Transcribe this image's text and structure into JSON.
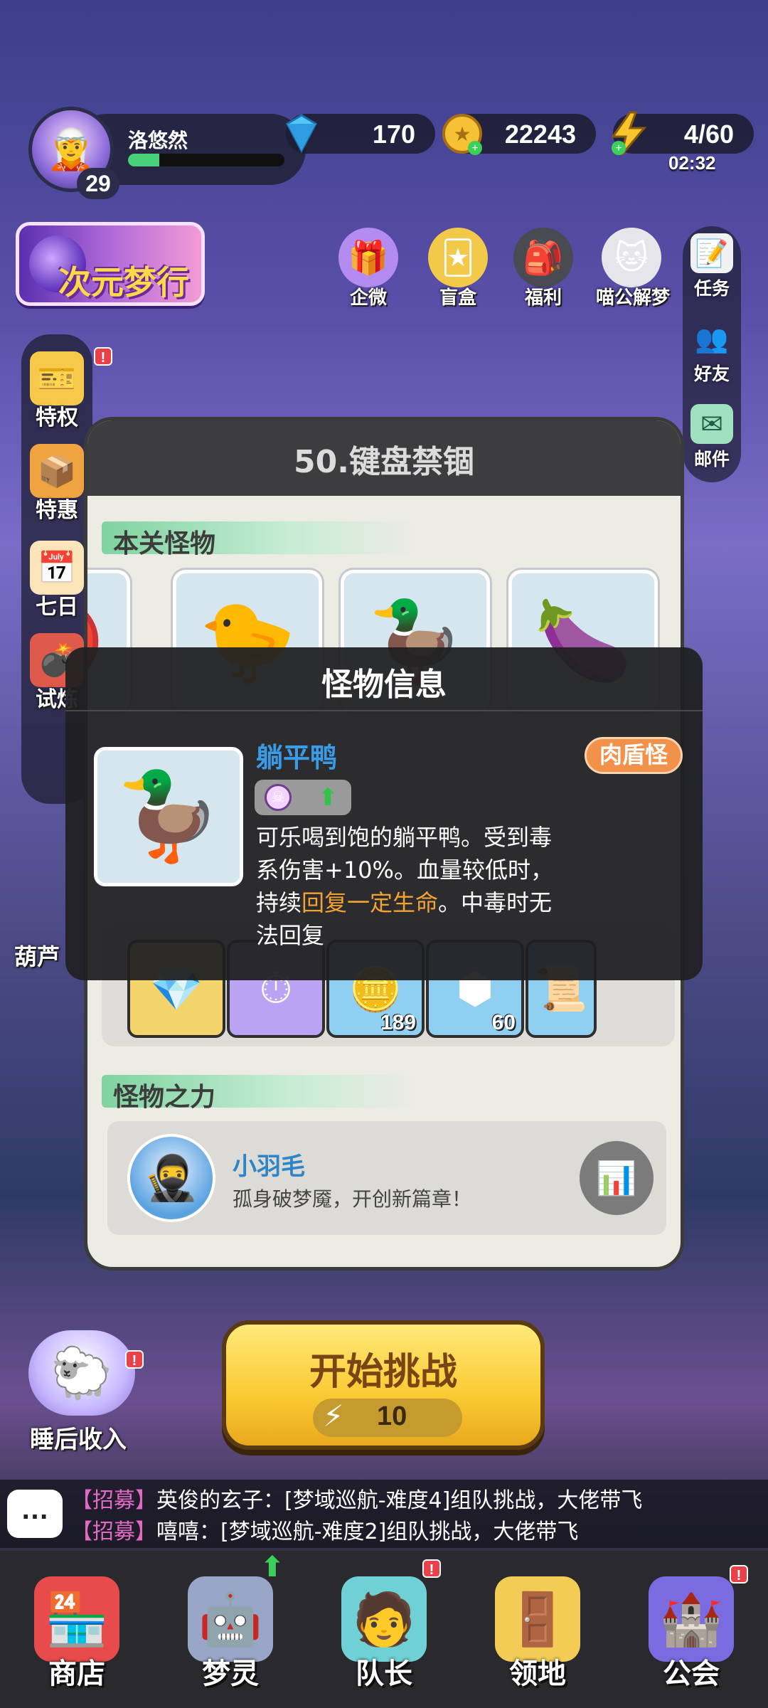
{
  "player": {
    "name": "洛悠然",
    "level": "29",
    "xp_fraction": 0.2
  },
  "resources": {
    "gems": "170",
    "coins": "22243",
    "energy": "4/60",
    "energy_timer": "02:32"
  },
  "banner": {
    "label": "次元梦行"
  },
  "top_icons": [
    {
      "label": "企微",
      "icon": "gift-icon"
    },
    {
      "label": "盲盒",
      "icon": "card-icon"
    },
    {
      "label": "福利",
      "icon": "bag-icon"
    },
    {
      "label": "喵公解梦",
      "icon": "cat-icon"
    }
  ],
  "right_menu": [
    {
      "label": "任务",
      "icon": "notebook-icon"
    },
    {
      "label": "好友",
      "icon": "friends-icon"
    },
    {
      "label": "邮件",
      "icon": "mail-icon"
    }
  ],
  "left_menu": [
    {
      "label": "特权",
      "icon": "tickets-icon"
    },
    {
      "label": "特惠",
      "icon": "box-icon"
    },
    {
      "label": "七日",
      "icon": "calendar-icon"
    },
    {
      "label": "试炼",
      "icon": "cannon-icon"
    }
  ],
  "left_extra": {
    "gourd_label": "葫芦"
  },
  "stage": {
    "title": "50.键盘禁锢",
    "monsters_header": "本关怪物",
    "power_header": "怪物之力",
    "reward_counts": [
      "189",
      "60"
    ],
    "power": {
      "name": "小羽毛",
      "desc": "孤身破梦魇，开创新篇章！"
    }
  },
  "monster_info": {
    "header": "怪物信息",
    "name": "躺平鸭",
    "type": "肉盾怪",
    "desc_part1": "可乐喝到饱的躺平鸭。受到毒系伤害+10%。血量较低时，持续",
    "desc_highlight": "回复一定生命",
    "desc_part2": "。中毒时无法回复"
  },
  "start_button": {
    "label": "开始挑战",
    "cost": "10"
  },
  "sleep_income": {
    "label": "睡后收入"
  },
  "chat": [
    {
      "tag": "【招募】",
      "text": "英俊的玄子：[梦域巡航-难度4]组队挑战，大佬带飞"
    },
    {
      "tag": "【招募】",
      "text": "嘻嘻：[梦域巡航-难度2]组队挑战，大佬带飞"
    }
  ],
  "nav": [
    {
      "label": "商店",
      "icon": "shop-icon"
    },
    {
      "label": "梦灵",
      "icon": "robot-icon"
    },
    {
      "label": "队长",
      "icon": "captain-icon"
    },
    {
      "label": "领地",
      "icon": "door-icon"
    },
    {
      "label": "公会",
      "icon": "guild-icon"
    }
  ],
  "colors": {
    "monster_name": "#3a9be6",
    "highlight": "#f3a233",
    "type_badge": "#f2914a",
    "chat_tag": "#e16ac4",
    "start_button": "#f9c930"
  }
}
